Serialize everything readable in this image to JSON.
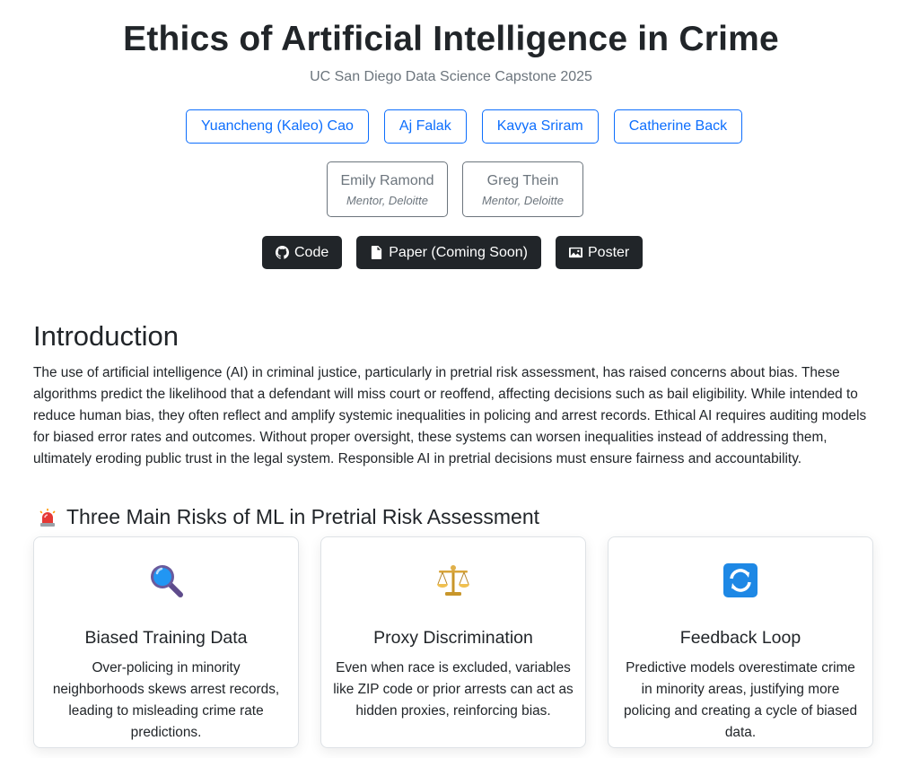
{
  "header": {
    "title": "Ethics of Artificial Intelligence in Crime",
    "subtitle": "UC San Diego Data Science Capstone 2025"
  },
  "authors": [
    "Yuancheng (Kaleo) Cao",
    "Aj Falak",
    "Kavya Sriram",
    "Catherine Back"
  ],
  "mentors": [
    {
      "name": "Emily Ramond",
      "role": "Mentor, Deloitte"
    },
    {
      "name": "Greg Thein",
      "role": "Mentor, Deloitte"
    }
  ],
  "links": {
    "code": "Code",
    "paper": "Paper (Coming Soon)",
    "poster": "Poster"
  },
  "introduction": {
    "heading": "Introduction",
    "text": "The use of artificial intelligence (AI) in criminal justice, particularly in pretrial risk assessment, has raised concerns about bias. These algorithms predict the likelihood that a defendant will miss court or reoffend, affecting decisions such as bail eligibility. While intended to reduce human bias, they often reflect and amplify systemic inequalities in policing and arrest records. Ethical AI requires auditing models for biased error rates and outcomes. Without proper oversight, these systems can worsen inequalities instead of addressing them, ultimately eroding public trust in the legal system. Responsible AI in pretrial decisions must ensure fairness and accountability."
  },
  "risks": {
    "heading": "Three Main Risks of ML in Pretrial Risk Assessment",
    "heading_icon": "siren-icon",
    "cards": [
      {
        "icon": "magnifying-glass-icon",
        "title": "Biased Training Data",
        "text": "Over-policing in minority neighborhoods skews arrest records, leading to misleading crime rate predictions."
      },
      {
        "icon": "balance-scale-icon",
        "title": "Proxy Discrimination",
        "text": "Even when race is excluded, variables like ZIP code or prior arrests can act as hidden proxies, reinforcing bias."
      },
      {
        "icon": "refresh-icon",
        "title": "Feedback Loop",
        "text": "Predictive models overestimate crime in minority areas, justifying more policing and creating a cycle of biased data."
      }
    ]
  },
  "colors": {
    "primary": "#0d6efd",
    "secondary": "#6c757d",
    "dark": "#212529"
  }
}
